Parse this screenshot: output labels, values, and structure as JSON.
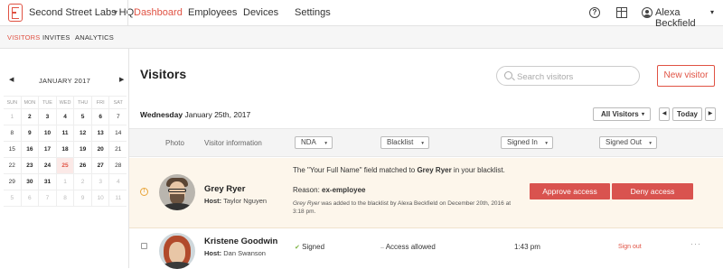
{
  "topnav": {
    "org_name": "Second Street Labs HQ",
    "tabs": [
      "Dashboard",
      "Employees",
      "Devices",
      "Settings"
    ],
    "active_tab": "Dashboard",
    "user_name": "Alexa Beckfield"
  },
  "subnav": {
    "items": [
      "VISITORS",
      "INVITES",
      "ANALYTICS"
    ],
    "active": "VISITORS"
  },
  "calendar": {
    "month": "JANUARY 2017",
    "weekdays": [
      "SUN",
      "MON",
      "TUE",
      "WED",
      "THU",
      "FRI",
      "SAT"
    ],
    "weeks": [
      [
        "1",
        "2",
        "3",
        "4",
        "5",
        "6",
        "7"
      ],
      [
        "8",
        "9",
        "10",
        "11",
        "12",
        "13",
        "14"
      ],
      [
        "15",
        "16",
        "17",
        "18",
        "19",
        "20",
        "21"
      ],
      [
        "22",
        "23",
        "24",
        "25",
        "26",
        "27",
        "28"
      ],
      [
        "29",
        "30",
        "31",
        "1",
        "2",
        "3",
        "4"
      ],
      [
        "5",
        "6",
        "7",
        "8",
        "9",
        "10",
        "11"
      ]
    ],
    "selected_day": "25"
  },
  "main": {
    "title": "Visitors",
    "search_placeholder": "Search visitors",
    "new_visitor_label": "New visitor",
    "date_weekday": "Wednesday",
    "date_rest": "January 25th, 2017",
    "filter_label": "All Visitors",
    "today_label": "Today",
    "columns": {
      "photo": "Photo",
      "visitor_info": "Visitor information",
      "nda": "NDA",
      "blacklist": "Blacklist",
      "signed_in": "Signed In",
      "signed_out": "Signed Out"
    }
  },
  "rows": [
    {
      "name": "Grey Ryer",
      "host_label": "Host:",
      "host": "Taylor Nguyen",
      "alert_pre": "The \"Your Full Name\" field matched to ",
      "alert_name": "Grey Ryer",
      "alert_post": " in your blacklist.",
      "reason_label": "Reason: ",
      "reason": "ex-employee",
      "note_name": "Grey Ryer",
      "note_rest": " was added to the blacklist by Alexa Beckfield on December 20th, 2016 at 3:18 pm.",
      "approve_label": "Approve access",
      "deny_label": "Deny access"
    },
    {
      "name": "Kristene Goodwin",
      "host_label": "Host:",
      "host": "Dan Swanson",
      "nda": "Signed",
      "blacklist": "Access allowed",
      "signed_in": "1:43 pm",
      "signed_out": "Sign out"
    }
  ],
  "colors": {
    "accent": "#e05243",
    "warning_bg": "#fdf6eb",
    "danger": "#d9534f"
  }
}
